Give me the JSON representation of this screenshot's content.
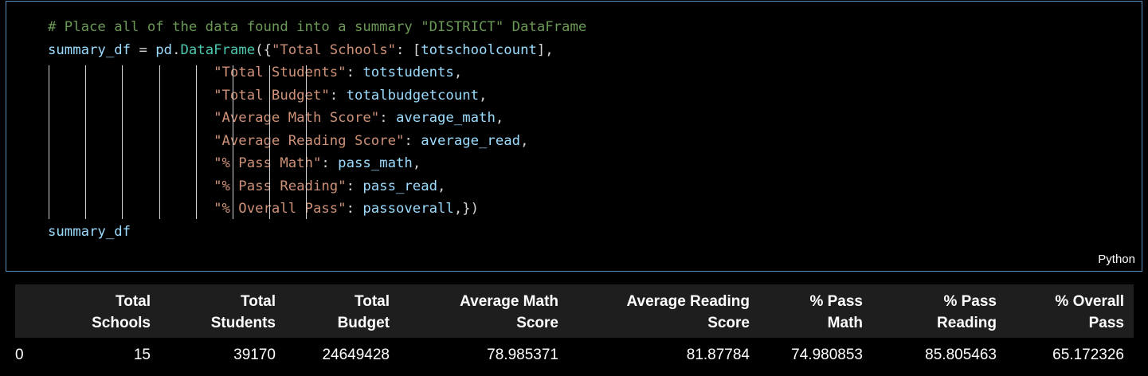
{
  "cell": {
    "language_label": "Python",
    "code_lines": [
      [
        {
          "t": "# Place all of the data found into a summary \"DISTRICT\" DataFrame",
          "c": "c-comment"
        }
      ],
      [
        {
          "t": "summary_df",
          "c": "c-var"
        },
        {
          "t": " = ",
          "c": "c-pl"
        },
        {
          "t": "pd",
          "c": "c-var"
        },
        {
          "t": ".",
          "c": "c-pl"
        },
        {
          "t": "DataFrame",
          "c": "c-cls"
        },
        {
          "t": "({",
          "c": "c-pl"
        },
        {
          "t": "\"Total Schools\"",
          "c": "c-str"
        },
        {
          "t": ": [",
          "c": "c-pl"
        },
        {
          "t": "totschoolcount",
          "c": "c-var"
        },
        {
          "t": "],",
          "c": "c-pl"
        }
      ],
      [
        {
          "t": "                    ",
          "c": "c-pl"
        },
        {
          "t": "\"Total Students\"",
          "c": "c-str"
        },
        {
          "t": ": ",
          "c": "c-pl"
        },
        {
          "t": "totstudents",
          "c": "c-var"
        },
        {
          "t": ",",
          "c": "c-pl"
        }
      ],
      [
        {
          "t": "                    ",
          "c": "c-pl"
        },
        {
          "t": "\"Total Budget\"",
          "c": "c-str"
        },
        {
          "t": ": ",
          "c": "c-pl"
        },
        {
          "t": "totalbudgetcount",
          "c": "c-var"
        },
        {
          "t": ",",
          "c": "c-pl"
        }
      ],
      [
        {
          "t": "                    ",
          "c": "c-pl"
        },
        {
          "t": "\"Average Math Score\"",
          "c": "c-str"
        },
        {
          "t": ": ",
          "c": "c-pl"
        },
        {
          "t": "average_math",
          "c": "c-var"
        },
        {
          "t": ",",
          "c": "c-pl"
        }
      ],
      [
        {
          "t": "                    ",
          "c": "c-pl"
        },
        {
          "t": "\"Average Reading Score\"",
          "c": "c-str"
        },
        {
          "t": ": ",
          "c": "c-pl"
        },
        {
          "t": "average_read",
          "c": "c-var"
        },
        {
          "t": ",",
          "c": "c-pl"
        }
      ],
      [
        {
          "t": "                    ",
          "c": "c-pl"
        },
        {
          "t": "\"% Pass Math\"",
          "c": "c-str"
        },
        {
          "t": ": ",
          "c": "c-pl"
        },
        {
          "t": "pass_math",
          "c": "c-var"
        },
        {
          "t": ",",
          "c": "c-pl"
        }
      ],
      [
        {
          "t": "                    ",
          "c": "c-pl"
        },
        {
          "t": "\"% Pass Reading\"",
          "c": "c-str"
        },
        {
          "t": ": ",
          "c": "c-pl"
        },
        {
          "t": "pass_read",
          "c": "c-var"
        },
        {
          "t": ",",
          "c": "c-pl"
        }
      ],
      [
        {
          "t": "                    ",
          "c": "c-pl"
        },
        {
          "t": "\"% Overall Pass\"",
          "c": "c-str"
        },
        {
          "t": ": ",
          "c": "c-pl"
        },
        {
          "t": "passoverall",
          "c": "c-var"
        },
        {
          "t": ",})",
          "c": "c-pl"
        }
      ],
      [
        {
          "t": "summary_df",
          "c": "c-var"
        }
      ]
    ]
  },
  "dataframe": {
    "headers": [
      [
        "",
        ""
      ],
      [
        "Total",
        "Schools"
      ],
      [
        "Total",
        "Students"
      ],
      [
        "Total",
        "Budget"
      ],
      [
        "Average Math",
        "Score"
      ],
      [
        "Average Reading",
        "Score"
      ],
      [
        "% Pass",
        "Math"
      ],
      [
        "% Pass",
        "Reading"
      ],
      [
        "% Overall",
        "Pass"
      ]
    ],
    "rows": [
      [
        "0",
        "15",
        "39170",
        "24649428",
        "78.985371",
        "81.87784",
        "74.980853",
        "85.805463",
        "65.172326"
      ]
    ]
  },
  "colors": {
    "background": "#000000",
    "cell_border": "#5b8fbd",
    "header_bg": "#1e1e1e",
    "comment": "#6a9955",
    "string": "#ce9178",
    "variable": "#9cdcfe",
    "class": "#4ec9b0"
  }
}
